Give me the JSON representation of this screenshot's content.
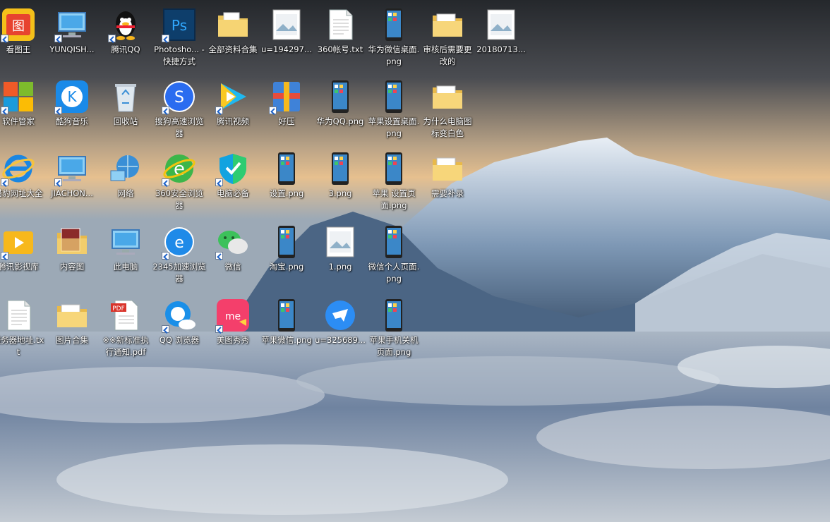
{
  "desktop": {
    "icons": [
      {
        "label": "看图王",
        "icon": "kantuwang-app-icon",
        "shortcut": true
      },
      {
        "label": "YUNQISH...",
        "icon": "computer-icon",
        "shortcut": true
      },
      {
        "label": "腾讯QQ",
        "icon": "qq-penguin-icon",
        "shortcut": true
      },
      {
        "label": "Photosho... - 快捷方式",
        "icon": "photoshop-icon",
        "shortcut": true
      },
      {
        "label": "全部资料合集",
        "icon": "folder-docs-icon",
        "shortcut": false
      },
      {
        "label": "u=194297...",
        "icon": "image-file-icon",
        "shortcut": false
      },
      {
        "label": "360帐号.txt",
        "icon": "text-file-icon",
        "shortcut": false
      },
      {
        "label": "华为微信桌面.png",
        "icon": "phone-screenshot-icon",
        "shortcut": false
      },
      {
        "label": "审核后需要更改的",
        "icon": "folder-icon",
        "shortcut": false
      },
      {
        "label": "20180713...",
        "icon": "image-file-icon",
        "shortcut": false
      },
      {
        "label": "软件管家",
        "icon": "software-manager-icon",
        "shortcut": true
      },
      {
        "label": "酷狗音乐",
        "icon": "kugou-icon",
        "shortcut": true
      },
      {
        "label": "回收站",
        "icon": "recycle-bin-icon",
        "shortcut": false
      },
      {
        "label": "搜狗高速浏览器",
        "icon": "sogou-browser-icon",
        "shortcut": true
      },
      {
        "label": "腾讯视频",
        "icon": "tencent-video-icon",
        "shortcut": true
      },
      {
        "label": "好压",
        "icon": "haozip-icon",
        "shortcut": true
      },
      {
        "label": "华为QQ.png",
        "icon": "phone-screenshot-icon",
        "shortcut": false
      },
      {
        "label": "苹果设置桌面.png",
        "icon": "phone-screenshot-icon",
        "shortcut": false
      },
      {
        "label": "为什么电脑图标变白色",
        "icon": "folder-icon",
        "shortcut": false
      },
      {
        "label": "猎豹网址大全",
        "icon": "ie-browser-icon",
        "shortcut": true
      },
      {
        "label": "JIACHON...",
        "icon": "computer-icon",
        "shortcut": true
      },
      {
        "label": "网络",
        "icon": "network-icon",
        "shortcut": false
      },
      {
        "label": "360安全浏览器",
        "icon": "360-browser-icon",
        "shortcut": true
      },
      {
        "label": "电脑必备",
        "icon": "shield-icon",
        "shortcut": true
      },
      {
        "label": "设置.png",
        "icon": "phone-screenshot-icon",
        "shortcut": false
      },
      {
        "label": "3.png",
        "icon": "phone-screenshot-icon",
        "shortcut": false
      },
      {
        "label": "苹果 设置页面.png",
        "icon": "phone-screenshot-icon",
        "shortcut": false
      },
      {
        "label": "需要补录",
        "icon": "folder-icon",
        "shortcut": false
      },
      {
        "label": "腾讯影视库",
        "icon": "tencent-video-library-icon",
        "shortcut": true
      },
      {
        "label": "内容图",
        "icon": "folder-images-icon",
        "shortcut": false
      },
      {
        "label": "此电脑",
        "icon": "computer-icon",
        "shortcut": false
      },
      {
        "label": "2345加速浏览器",
        "icon": "2345-browser-icon",
        "shortcut": true
      },
      {
        "label": "微信",
        "icon": "wechat-icon",
        "shortcut": true
      },
      {
        "label": "淘宝.png",
        "icon": "phone-screenshot-icon",
        "shortcut": false
      },
      {
        "label": "1.png",
        "icon": "image-file-icon",
        "shortcut": false
      },
      {
        "label": "微信个人页面.png",
        "icon": "phone-screenshot-icon",
        "shortcut": false
      },
      {
        "label": "服务器地址.txt",
        "icon": "text-file-icon",
        "shortcut": false
      },
      {
        "label": "图片合集",
        "icon": "folder-icon",
        "shortcut": false
      },
      {
        "label": "※※新标准执行通知.pdf",
        "icon": "pdf-file-icon",
        "shortcut": false
      },
      {
        "label": "QQ 浏览器",
        "icon": "qq-browser-icon",
        "shortcut": true
      },
      {
        "label": "美图秀秀",
        "icon": "meitu-icon",
        "shortcut": true
      },
      {
        "label": "苹果微信.png",
        "icon": "phone-screenshot-icon",
        "shortcut": false
      },
      {
        "label": "u=325689...",
        "icon": "dingtalk-icon",
        "shortcut": false
      },
      {
        "label": "苹果手机关机页面.png",
        "icon": "phone-screenshot-icon",
        "shortcut": false
      }
    ]
  }
}
